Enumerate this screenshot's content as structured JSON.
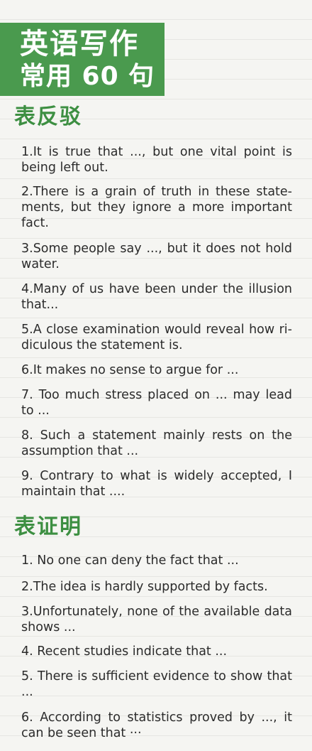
{
  "banner": {
    "line1": "英语写作",
    "line2": "常用 60 句"
  },
  "sections": [
    {
      "title": "表反驳",
      "items": [
        "1.It is true that ..., but one vital point is being left out.",
        "2.There is a grain of truth in these state-ments, but they ignore a more important fact.",
        "3.Some people say ..., but it does not hold water.",
        "4.Many of us have been under the illusion that...",
        "5.A close examination would reveal how ri-diculous the statement is.",
        "6.It makes no sense to argue for ...",
        "7. Too much stress placed on ... may lead to ...",
        "8. Such a statement mainly rests on the assumption that ...",
        "9. Contrary to what is widely accepted, I maintain that ...."
      ]
    },
    {
      "title": "表证明",
      "items": [
        "1. No one can deny the fact that ...",
        "2.The idea is hardly supported by facts.",
        "3.Unfortunately, none of the available data shows ...",
        "4. Recent studies indicate that ...",
        "5. There is sufficient evidence to show that ...",
        "6. According to statistics proved by ..., it can be seen that ···"
      ]
    }
  ]
}
